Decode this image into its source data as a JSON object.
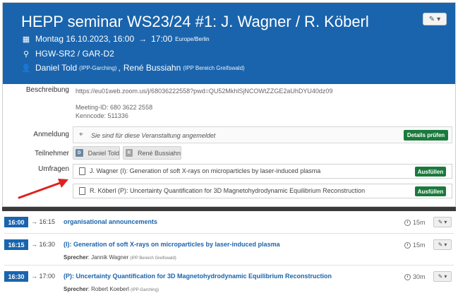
{
  "event": {
    "title": "HEPP seminar WS23/24 #1: J. Wagner / R. Köberl",
    "date": "Montag 16.10.2023, 16:00",
    "arrow": "→",
    "end_time": "17:00",
    "timezone": "Europe/Berlin",
    "location": "HGW-SR2 / GAR-D2",
    "chairs": [
      {
        "name": "Daniel Told",
        "affiliation": "(IPP-Garching)"
      },
      {
        "name": "René Bussiahn",
        "affiliation": "(IPP Bereich Greifswald)"
      }
    ],
    "chairs_separator": ","
  },
  "details": {
    "description_label": "Beschreibung",
    "description_url": "https://eu01web.zoom.us/j/68036222558?pwd=QU52MkhlSjNCOWtZZGE2aUhDYU40dz09",
    "meeting_id": "Meeting-ID: 680 3622 2558",
    "passcode": "Kenncode: 511336",
    "registration_label": "Anmeldung",
    "registration_text": "Sie sind für diese Veranstaltung angemeldet",
    "registration_button": "Details prüfen",
    "participants_label": "Teilnehmer",
    "participants": [
      {
        "initial": "D",
        "name": "Daniel Told"
      },
      {
        "initial": "R",
        "name": "René Bussiahn"
      }
    ],
    "surveys_label": "Umfragen",
    "surveys": [
      {
        "title": "J. Wagner (I): Generation of soft X-rays on microparticles by laser-induced plasma",
        "button": "Ausfüllen"
      },
      {
        "title": "R. Köberl (P): Uncertainty Quantification for 3D Magnetohydrodynamic Equilibrium Reconstruction",
        "button": "Ausfüllen"
      }
    ]
  },
  "timetable": [
    {
      "start": "16:00",
      "end": "16:15",
      "title": "organisational announcements",
      "duration": "15m"
    },
    {
      "start": "16:15",
      "end": "16:30",
      "title": "(I): Generation of soft X-rays on microparticles by laser-induced plasma",
      "speaker_label": "Sprecher",
      "speaker": "Jannik Wagner",
      "speaker_affiliation": "(IPP Bereich Greifswald)",
      "duration": "15m"
    },
    {
      "start": "16:30",
      "end": "17:00",
      "title": "(P): Uncertainty Quantification for 3D Magnetohydrodynamic Equilibrium Reconstruction",
      "speaker_label": "Sprecher",
      "speaker": "Robert Koeberl",
      "speaker_affiliation": "(IPP-Garching)",
      "duration": "30m"
    }
  ],
  "colors": {
    "header_bg": "#1a64ad",
    "accent_green": "#1a7a3c",
    "arrow": "#e02020"
  },
  "icons": [
    "calendar-icon",
    "map-marker-icon",
    "user-icon",
    "edit-icon",
    "caret-down-icon",
    "tag-icon",
    "document-icon",
    "clock-icon",
    "arrow-annotation"
  ]
}
